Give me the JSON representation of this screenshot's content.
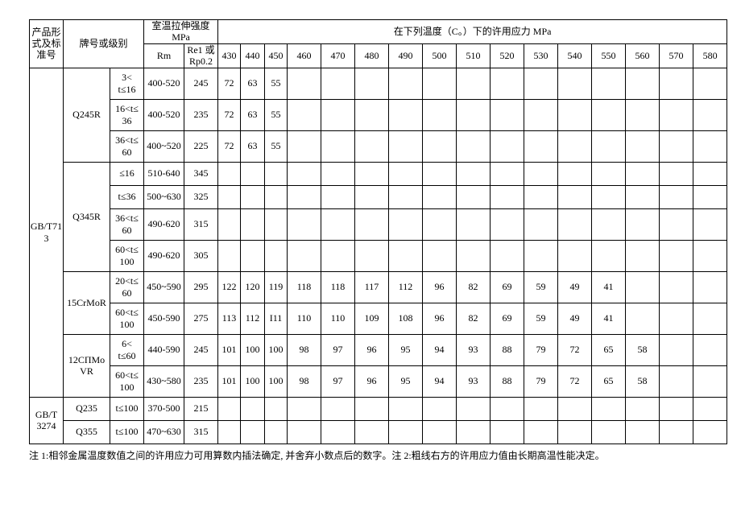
{
  "headers": {
    "col_std": "产品形\n式及标\n准号",
    "col_grade": "牌号或级别",
    "col_tensile": "室温拉伸强度\nMPa",
    "col_temp": "在下列温度（C。）下的许用应力 MPa",
    "col_rm": "Rm",
    "col_re": "Re1 或\nRp0.2",
    "temps": [
      "430",
      "440",
      "450",
      "460",
      "470",
      "480",
      "490",
      "500",
      "510",
      "520",
      "530",
      "540",
      "550",
      "560",
      "570",
      "580"
    ]
  },
  "rows": [
    {
      "std": "GB/T71\n3",
      "grade": "Q245R",
      "th": "3<\nt≤16",
      "rm": "400-520",
      "re": "245",
      "v": [
        "72",
        "63",
        "55",
        "",
        "",
        "",
        "",
        "",
        "",
        "",
        "",
        "",
        "",
        "",
        "",
        ""
      ]
    },
    {
      "std": "",
      "grade": "",
      "th": "16<t≤\n36",
      "rm": "400-520",
      "re": "235",
      "v": [
        "72",
        "63",
        "55",
        "",
        "",
        "",
        "",
        "",
        "",
        "",
        "",
        "",
        "",
        "",
        "",
        ""
      ]
    },
    {
      "std": "",
      "grade": "",
      "th": "36<t≤\n60",
      "rm": "400~520",
      "re": "225",
      "v": [
        "72",
        "63",
        "55",
        "",
        "",
        "",
        "",
        "",
        "",
        "",
        "",
        "",
        "",
        "",
        "",
        ""
      ]
    },
    {
      "std": "",
      "grade": "Q345R",
      "th": "≤16",
      "rm": "510-640",
      "re": "345",
      "v": [
        "",
        "",
        "",
        "",
        "",
        "",
        "",
        "",
        "",
        "",
        "",
        "",
        "",
        "",
        "",
        ""
      ]
    },
    {
      "std": "",
      "grade": "",
      "th": "t≤36",
      "rm": "500~630",
      "re": "325",
      "v": [
        "",
        "",
        "",
        "",
        "",
        "",
        "",
        "",
        "",
        "",
        "",
        "",
        "",
        "",
        "",
        ""
      ]
    },
    {
      "std": "",
      "grade": "",
      "th": "36<t≤\n60",
      "rm": "490-620",
      "re": "315",
      "v": [
        "",
        "",
        "",
        "",
        "",
        "",
        "",
        "",
        "",
        "",
        "",
        "",
        "",
        "",
        "",
        ""
      ]
    },
    {
      "std": "",
      "grade": "",
      "th": "60<t≤\n100",
      "rm": "490-620",
      "re": "305",
      "v": [
        "",
        "",
        "",
        "",
        "",
        "",
        "",
        "",
        "",
        "",
        "",
        "",
        "",
        "",
        "",
        ""
      ]
    },
    {
      "std": "",
      "grade": "15CrMoR",
      "th": "20<t≤\n60",
      "rm": "450~590",
      "re": "295",
      "v": [
        "122",
        "120",
        "119",
        "118",
        "118",
        "117",
        "112",
        "96",
        "82",
        "69",
        "59",
        "49",
        "41",
        "",
        "",
        ""
      ]
    },
    {
      "std": "",
      "grade": "",
      "th": "60<t≤\n100",
      "rm": "450-590",
      "re": "275",
      "v": [
        "113",
        "112",
        "I11",
        "110",
        "110",
        "109",
        "108",
        "96",
        "82",
        "69",
        "59",
        "49",
        "41",
        "",
        "",
        ""
      ]
    },
    {
      "std": "",
      "grade": "12CПMo\nVR",
      "th": "6<\nt≤60",
      "rm": "440-590",
      "re": "245",
      "v": [
        "101",
        "100",
        "100",
        "98",
        "97",
        "96",
        "95",
        "94",
        "93",
        "88",
        "79",
        "72",
        "65",
        "58",
        "",
        ""
      ]
    },
    {
      "std": "",
      "grade": "",
      "th": "60<t≤\n100",
      "rm": "430~580",
      "re": "235",
      "v": [
        "101",
        "100",
        "100",
        "98",
        "97",
        "96",
        "95",
        "94",
        "93",
        "88",
        "79",
        "72",
        "65",
        "58",
        "",
        ""
      ]
    },
    {
      "std": "GB/T\n3274",
      "grade": "Q235",
      "th": "t≤100",
      "rm": "370-500",
      "re": "215",
      "v": [
        "",
        "",
        "",
        "",
        "",
        "",
        "",
        "",
        "",
        "",
        "",
        "",
        "",
        "",
        "",
        ""
      ]
    },
    {
      "std": "",
      "grade": "Q355",
      "th": "t≤100",
      "rm": "470~630",
      "re": "315",
      "v": [
        "",
        "",
        "",
        "",
        "",
        "",
        "",
        "",
        "",
        "",
        "",
        "",
        "",
        "",
        "",
        ""
      ]
    }
  ],
  "spans": {
    "std": [
      {
        "start": 0,
        "span": 11
      },
      {
        "start": 11,
        "span": 2
      }
    ],
    "grade": [
      {
        "start": 0,
        "span": 3
      },
      {
        "start": 3,
        "span": 4
      },
      {
        "start": 7,
        "span": 2
      },
      {
        "start": 9,
        "span": 2
      },
      {
        "start": 11,
        "span": 1
      },
      {
        "start": 12,
        "span": 1
      }
    ]
  },
  "footnote": "注 1:相邻金属温度数值之间的许用应力可用算数内插法确定, 并舍弃小数点后的数字。注 2:粗线右方的许用应力值由长期高温性能决定。"
}
